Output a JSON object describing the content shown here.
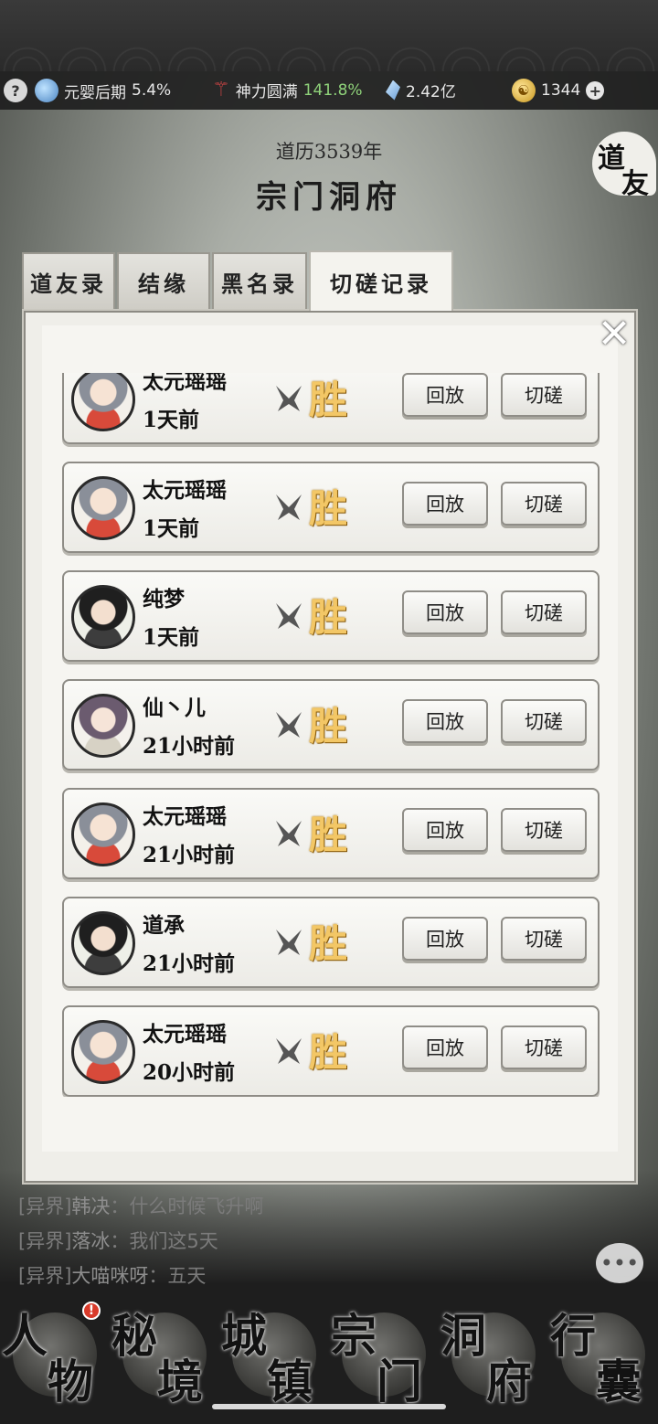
{
  "status": {
    "realm_label": "元婴后期",
    "realm_percent": "5.4%",
    "power_label": "神力圆满",
    "power_percent": "141.8%",
    "crystal": "2.42亿",
    "coins": "1344"
  },
  "header": {
    "year": "道历3539年",
    "title": "宗门洞府",
    "friend_seal": [
      "道",
      "友"
    ]
  },
  "tabs": [
    {
      "label": "道友录",
      "active": false
    },
    {
      "label": "结缘",
      "active": false
    },
    {
      "label": "黑名录",
      "active": false
    },
    {
      "label": "切磋记录",
      "active": true
    }
  ],
  "records": [
    {
      "name": "太元瑶瑶",
      "time": "1天前",
      "result": "胜",
      "avatar": "silver"
    },
    {
      "name": "太元瑶瑶",
      "time": "1天前",
      "result": "胜",
      "avatar": "silver"
    },
    {
      "name": "纯梦",
      "time": "1天前",
      "result": "胜",
      "avatar": "dark"
    },
    {
      "name": "仙丶儿",
      "time": "21小时前",
      "result": "胜",
      "avatar": "purple"
    },
    {
      "name": "太元瑶瑶",
      "time": "21小时前",
      "result": "胜",
      "avatar": "silver"
    },
    {
      "name": "道承",
      "time": "21小时前",
      "result": "胜",
      "avatar": "dark"
    },
    {
      "name": "太元瑶瑶",
      "time": "20小时前",
      "result": "胜",
      "avatar": "silver"
    }
  ],
  "buttons": {
    "replay": "回放",
    "spar": "切磋"
  },
  "chat": [
    {
      "channel": "[异界]",
      "sender": "韩决",
      "sep": "：",
      "text": "什么时候飞升啊"
    },
    {
      "channel": "[异界]",
      "sender": "落冰",
      "sep": "：",
      "text": "我们这5天"
    },
    {
      "channel": "[异界]",
      "sender": "大喵咪呀",
      "sep": "：",
      "text": "五天"
    }
  ],
  "nav": [
    {
      "c1": "人",
      "c2": "物"
    },
    {
      "c1": "秘",
      "c2": "境"
    },
    {
      "c1": "城",
      "c2": "镇"
    },
    {
      "c1": "宗",
      "c2": "门"
    },
    {
      "c1": "洞",
      "c2": "府"
    },
    {
      "c1": "行",
      "c2": "囊"
    }
  ],
  "nav_badge": "!",
  "icons": {
    "help": "?",
    "close": "✕",
    "chat": "•••",
    "plus": "+"
  }
}
